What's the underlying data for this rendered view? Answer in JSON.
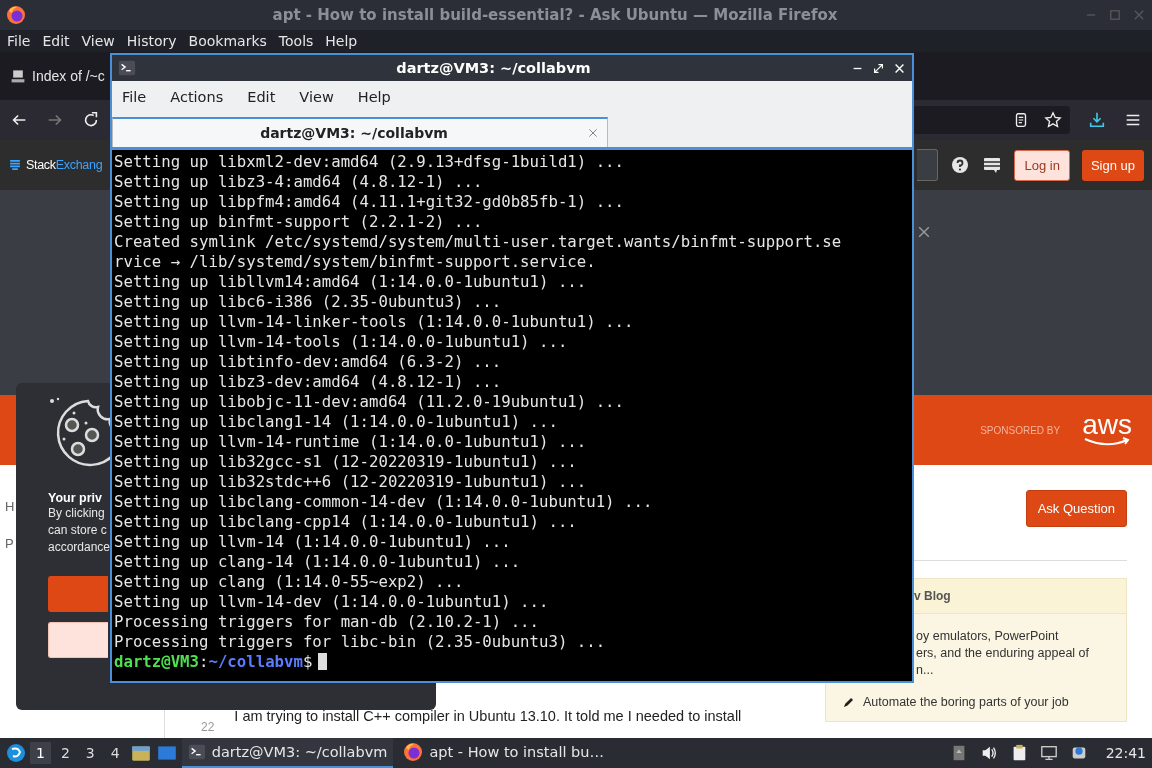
{
  "firefox": {
    "title": "apt - How to install build-essential? - Ask Ubuntu — Mozilla Firefox",
    "menu": [
      "File",
      "Edit",
      "View",
      "History",
      "Bookmarks",
      "Tools",
      "Help"
    ],
    "tab": {
      "title": "Index of /~c"
    },
    "site": {
      "logo_a": "Stack",
      "logo_b": "Exchang",
      "login": "Log in",
      "signup": "Sign up"
    },
    "banner": {
      "sponsored": "SPONSORED BY",
      "sponsor_logo": "aws"
    },
    "page": {
      "heading_fragment": "H",
      "meta_fragment": "P",
      "ask_button": "Ask Question",
      "vote_count": "22",
      "question_text": "I am trying to install C++ compiler in Ubuntu 13.10. It told me I needed to install"
    },
    "sidebar": {
      "blog_header": "v Blog",
      "blog_lines": [
        "oy emulators, PowerPoint",
        "ers, and the enduring appeal of",
        "n..."
      ],
      "item": "Automate the boring parts of your job"
    },
    "cookie": {
      "title": "Your priv",
      "lines": [
        "By clicking",
        "can store c",
        "accordance"
      ]
    }
  },
  "terminal": {
    "title": "dartz@VM3: ~/collabvm",
    "menu": [
      "File",
      "Actions",
      "Edit",
      "View",
      "Help"
    ],
    "tab": "dartz@VM3: ~/collabvm",
    "lines": [
      "Setting up libxml2-dev:amd64 (2.9.13+dfsg-1build1) ...",
      "Setting up libz3-4:amd64 (4.8.12-1) ...",
      "Setting up libpfm4:amd64 (4.11.1+git32-gd0b85fb-1) ...",
      "Setting up binfmt-support (2.2.1-2) ...",
      "Created symlink /etc/systemd/system/multi-user.target.wants/binfmt-support.se",
      "rvice → /lib/systemd/system/binfmt-support.service.",
      "Setting up libllvm14:amd64 (1:14.0.0-1ubuntu1) ...",
      "Setting up libc6-i386 (2.35-0ubuntu3) ...",
      "Setting up llvm-14-linker-tools (1:14.0.0-1ubuntu1) ...",
      "Setting up llvm-14-tools (1:14.0.0-1ubuntu1) ...",
      "Setting up libtinfo-dev:amd64 (6.3-2) ...",
      "Setting up libz3-dev:amd64 (4.8.12-1) ...",
      "Setting up libobjc-11-dev:amd64 (11.2.0-19ubuntu1) ...",
      "Setting up libclang1-14 (1:14.0.0-1ubuntu1) ...",
      "Setting up llvm-14-runtime (1:14.0.0-1ubuntu1) ...",
      "Setting up lib32gcc-s1 (12-20220319-1ubuntu1) ...",
      "Setting up lib32stdc++6 (12-20220319-1ubuntu1) ...",
      "Setting up libclang-common-14-dev (1:14.0.0-1ubuntu1) ...",
      "Setting up libclang-cpp14 (1:14.0.0-1ubuntu1) ...",
      "Setting up llvm-14 (1:14.0.0-1ubuntu1) ...",
      "Setting up clang-14 (1:14.0.0-1ubuntu1) ...",
      "Setting up clang (1:14.0-55~exp2) ...",
      "Setting up llvm-14-dev (1:14.0.0-1ubuntu1) ...",
      "Processing triggers for man-db (2.10.2-1) ...",
      "Processing triggers for libc-bin (2.35-0ubuntu3) ..."
    ],
    "prompt": {
      "user_host": "dartz@VM3",
      "separator": ":",
      "path": "~/collabvm",
      "symbol": "$"
    }
  },
  "taskbar": {
    "workspaces": [
      {
        "label": "1",
        "selected": true
      },
      {
        "label": "2",
        "selected": false
      },
      {
        "label": "3",
        "selected": false
      },
      {
        "label": "4",
        "selected": false
      }
    ],
    "tasks": [
      {
        "kind": "terminal",
        "label": "dartz@VM3: ~/collabvm",
        "selected": true
      },
      {
        "kind": "browser",
        "label": "apt - How to install bu…",
        "selected": false
      }
    ],
    "clock": "22:41"
  }
}
